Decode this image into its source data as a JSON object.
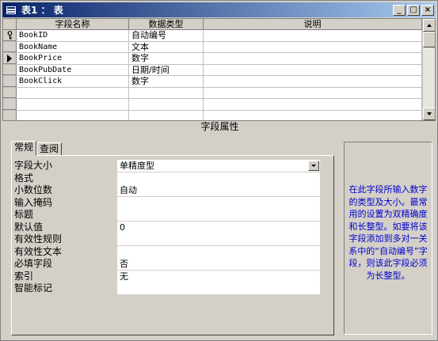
{
  "window": {
    "title": "表1 ： 表",
    "min_label": "_",
    "max_label": "□",
    "close_label": "×"
  },
  "grid": {
    "headers": [
      "字段名称",
      "数据类型",
      "说明"
    ],
    "rows": [
      {
        "name": "BookID",
        "type": "自动编号",
        "desc": "",
        "primary_key": true,
        "current": false
      },
      {
        "name": "BookName",
        "type": "文本",
        "desc": "",
        "primary_key": false,
        "current": false
      },
      {
        "name": "BookPrice",
        "type": "数字",
        "desc": "",
        "primary_key": false,
        "current": true
      },
      {
        "name": "BookPubDate",
        "type": "日期/时间",
        "desc": "",
        "primary_key": false,
        "current": false
      },
      {
        "name": "BookClick",
        "type": "数字",
        "desc": "",
        "primary_key": false,
        "current": false
      },
      {
        "name": "",
        "type": "",
        "desc": ""
      },
      {
        "name": "",
        "type": "",
        "desc": ""
      },
      {
        "name": "",
        "type": "",
        "desc": ""
      }
    ]
  },
  "properties": {
    "section_title": "字段属性",
    "tabs": [
      "常规",
      "查阅"
    ],
    "active_tab": "常规",
    "rows": [
      {
        "label": "字段大小",
        "value": "单精度型",
        "dropdown": true
      },
      {
        "label": "格式",
        "value": ""
      },
      {
        "label": "小数位数",
        "value": "自动"
      },
      {
        "label": "输入掩码",
        "value": ""
      },
      {
        "label": "标题",
        "value": ""
      },
      {
        "label": "默认值",
        "value": "0"
      },
      {
        "label": "有效性规则",
        "value": ""
      },
      {
        "label": "有效性文本",
        "value": ""
      },
      {
        "label": "必填字段",
        "value": "否"
      },
      {
        "label": "索引",
        "value": "无"
      },
      {
        "label": "智能标记",
        "value": ""
      }
    ]
  },
  "help": {
    "text": "在此字段所输入数字的类型及大小。最常用的设置为双精确度和长整型。如要将该字段添加到多对一关系中的“自动编号”字段，则该此字段必须为长整型。",
    "color": "#0000cc"
  }
}
